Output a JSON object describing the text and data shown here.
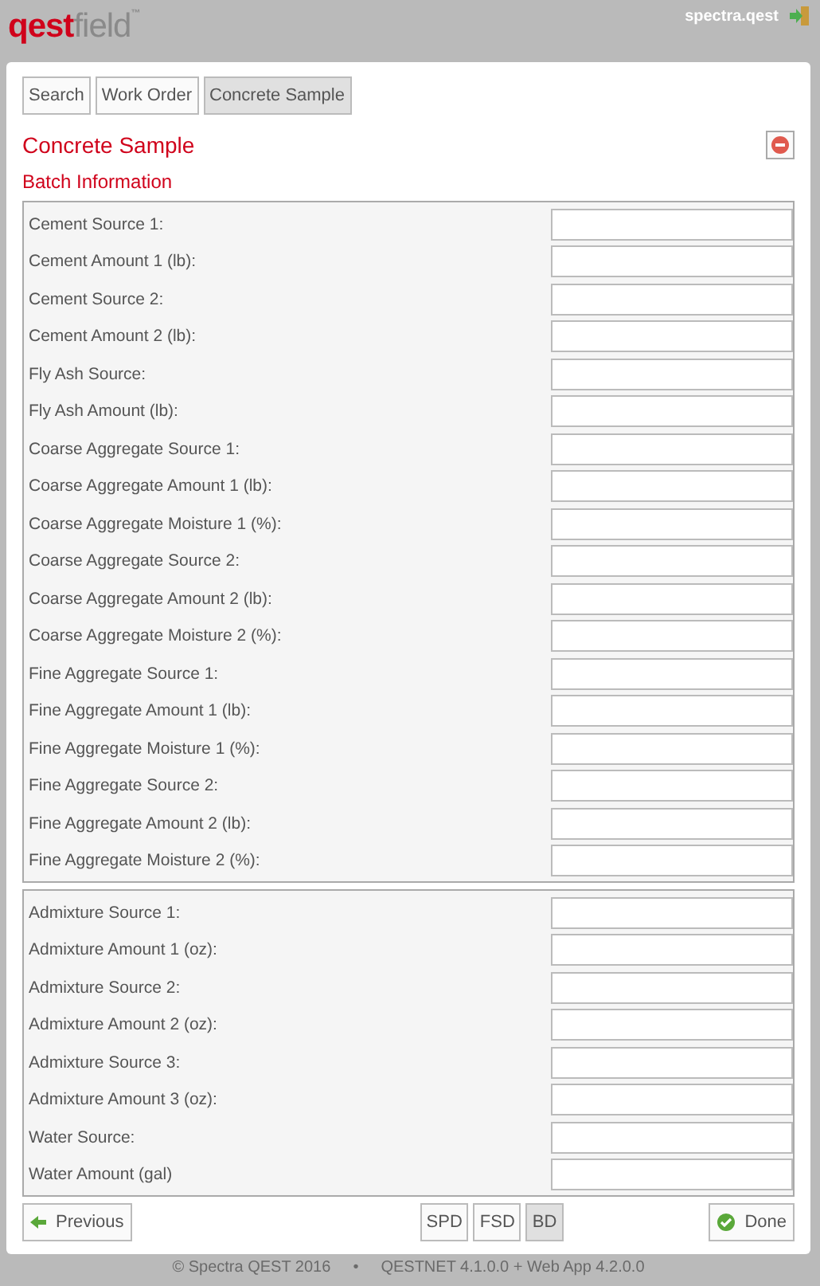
{
  "header": {
    "logo": {
      "part_1": "qest",
      "part_2": "field",
      "mark": "™"
    },
    "user": "spectra.qest"
  },
  "tabs": [
    {
      "label": "Search",
      "selected": false
    },
    {
      "label": "Work Order",
      "selected": false
    },
    {
      "label": "Concrete Sample",
      "selected": true
    }
  ],
  "title": "Concrete Sample",
  "section": "Batch Information",
  "groups": [
    {
      "fields": [
        {
          "label": "Cement Source 1:"
        },
        {
          "label": "Cement Amount 1 (lb):"
        },
        {
          "label": "Cement Source 2:"
        },
        {
          "label": "Cement Amount 2 (lb):"
        },
        {
          "label": "Fly Ash Source:"
        },
        {
          "label": "Fly Ash Amount (lb):"
        },
        {
          "label": "Coarse Aggregate Source 1:"
        },
        {
          "label": "Coarse Aggregate Amount 1 (lb):"
        },
        {
          "label": "Coarse Aggregate Moisture 1 (%):"
        },
        {
          "label": "Coarse Aggregate Source 2:"
        },
        {
          "label": "Coarse Aggregate Amount 2 (lb):"
        },
        {
          "label": "Coarse Aggregate Moisture 2 (%):"
        },
        {
          "label": "Fine Aggregate Source 1:"
        },
        {
          "label": "Fine Aggregate Amount 1 (lb):"
        },
        {
          "label": "Fine Aggregate Moisture 1 (%):"
        },
        {
          "label": "Fine Aggregate Source 2:"
        },
        {
          "label": "Fine Aggregate Amount 2 (lb):"
        },
        {
          "label": "Fine Aggregate Moisture 2 (%):"
        }
      ]
    },
    {
      "fields": [
        {
          "label": "Admixture Source 1:"
        },
        {
          "label": "Admixture Amount 1 (oz):"
        },
        {
          "label": "Admixture Source 2:"
        },
        {
          "label": "Admixture Amount 2 (oz):"
        },
        {
          "label": "Admixture Source 3:"
        },
        {
          "label": "Admixture Amount 3 (oz):"
        },
        {
          "label": "Water Source:"
        },
        {
          "label": "Water Amount (gal)"
        }
      ]
    }
  ],
  "nav": {
    "previous": "Previous",
    "pages": [
      {
        "label": "SPD",
        "selected": false
      },
      {
        "label": "FSD",
        "selected": false
      },
      {
        "label": "BD",
        "selected": true
      }
    ],
    "done": "Done"
  },
  "footer": {
    "copyright": "© Spectra QEST 2016",
    "separator": "•",
    "version": "QESTNET 4.1.0.0 + Web App 4.2.0.0"
  }
}
